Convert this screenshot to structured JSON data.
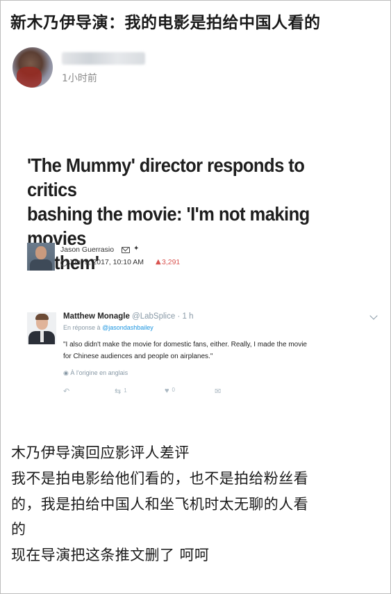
{
  "post": {
    "title": "新木乃伊导演：我的电影是拍给中国人看的",
    "time_ago": "1小时前"
  },
  "article": {
    "headline_lines": [
      "'The Mummy' director responds to critics",
      "bashing the movie: 'I'm not making movies",
      "for them'"
    ],
    "author_name": "Jason Guerrasio",
    "date": "Jun. 9, 2017, 10:10 AM",
    "share_count": "3,291"
  },
  "tweet": {
    "name": "Matthew Monagle",
    "handle": "@LabSplice",
    "dot": "·",
    "ago": "1 h",
    "reply_prefix": "En réponse à",
    "reply_to": "@jasondashbailey",
    "text_lines": [
      "\"I also didn't make the movie for domestic fans, either. Really, I made the movie",
      "for Chinese audiences and people on airplanes.\""
    ],
    "translation_note": "À l'origine en anglais",
    "retweets": "1",
    "likes": "0"
  },
  "body": {
    "lines": [
      "木乃伊导演回应影评人差评",
      "我不是拍电影给他们看的，也不是拍给粉丝看",
      "的，我是拍给中国人和坐飞机时太无聊的人看",
      "的",
      "现在导演把这条推文删了 呵呵"
    ]
  },
  "icons": {
    "mail": "mail-icon",
    "twitter": "twitter-bird-icon",
    "clock": "clock-icon",
    "flame": "flame-icon",
    "reply": "reply-icon",
    "retweet": "retweet-icon",
    "like": "heart-icon",
    "dm": "direct-message-icon",
    "more": "chevron-down-icon"
  },
  "colors": {
    "tweet_meta": "#8899a6",
    "tweet_link": "#1b95e0",
    "share_accent": "#d9534f"
  }
}
